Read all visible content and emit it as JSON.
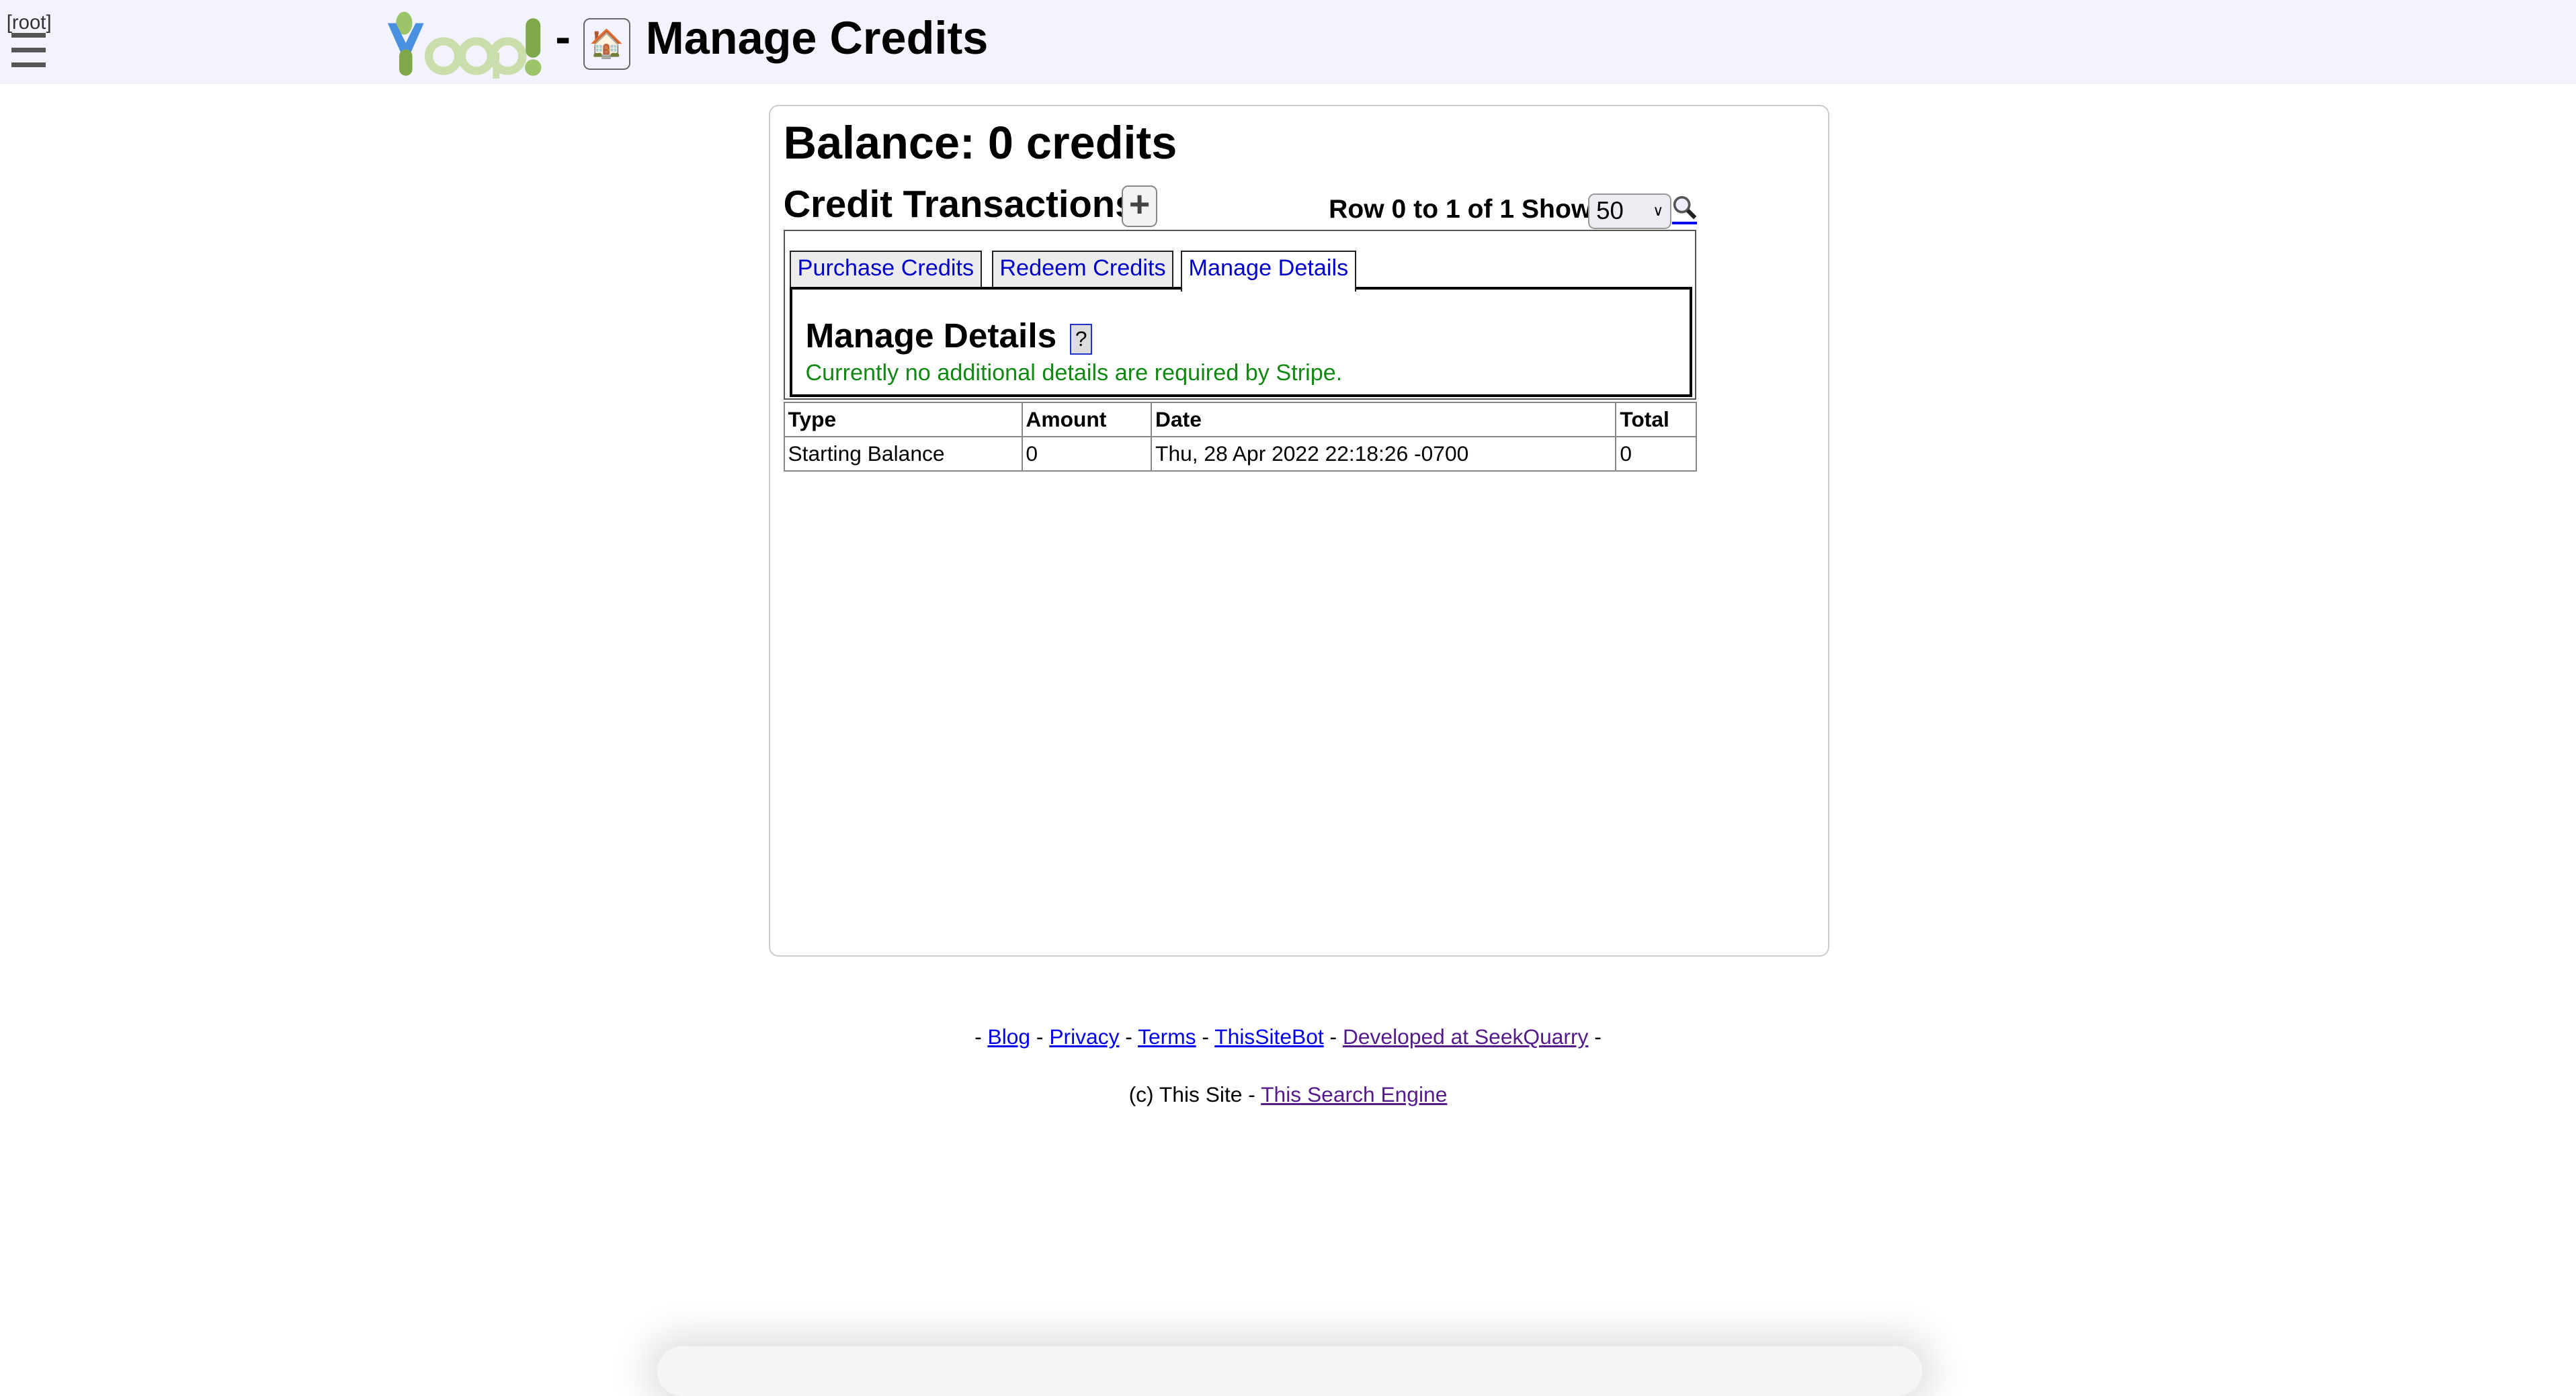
{
  "header": {
    "user_label": "[root]",
    "logo_alt": "Yioop!",
    "separator": "-",
    "home_icon": "house-icon",
    "title": "Manage Credits"
  },
  "main": {
    "balance": "Balance: 0 credits",
    "transactions_title": "Credit Transactions",
    "add_label": "+",
    "row_info": "Row 0 to 1 of 1 Show",
    "show_value": "50",
    "tabs": [
      {
        "label": "Purchase Credits",
        "active": false
      },
      {
        "label": "Redeem Credits",
        "active": false
      },
      {
        "label": "Manage Details",
        "active": true
      }
    ],
    "manage_details": {
      "title": "Manage Details",
      "help_label": "?",
      "message": "Currently no additional details are required by Stripe.",
      "message_color": "#118811"
    },
    "table": {
      "headers": [
        "Type",
        "Amount",
        "Date",
        "Total"
      ],
      "rows": [
        [
          "Starting Balance",
          "0",
          "Thu, 28 Apr 2022 22:18:26 -0700",
          "0"
        ]
      ]
    }
  },
  "footer": {
    "links": [
      "Blog",
      "Privacy",
      "Terms",
      "ThisSiteBot",
      "Developed at SeekQuarry"
    ],
    "copyright": "(c) This Site -",
    "engine_link": "This Search Engine"
  }
}
